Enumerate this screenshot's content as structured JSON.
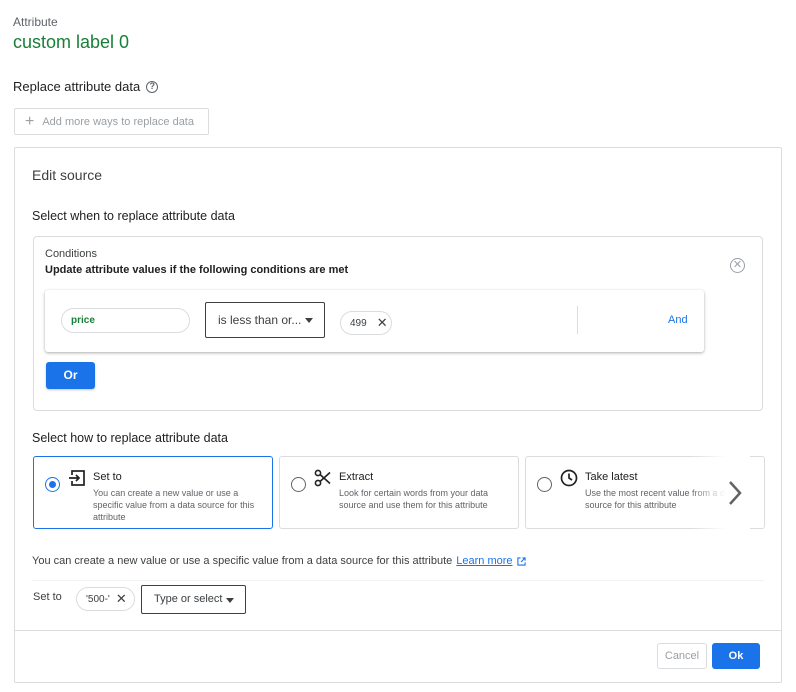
{
  "attribute": {
    "caption": "Attribute",
    "value": "custom label 0"
  },
  "replace_section": {
    "title": "Replace attribute data",
    "help_icon": "help-circle-icon",
    "add_more_label": "Add more ways to replace data"
  },
  "edit_source": {
    "title": "Edit source",
    "select_when_title": "Select when to replace attribute data",
    "conditions": {
      "title": "Conditions",
      "subtitle": "Update attribute values if the following conditions are met",
      "rule": {
        "attribute": "price",
        "operator": "is less than or...",
        "value": "499",
        "and_label": "And"
      },
      "or_label": "Or"
    },
    "select_how_title": "Select how to replace attribute data",
    "options": [
      {
        "icon": "input-arrow-icon",
        "title": "Set to",
        "description": "You can create a new value or use a specific value from a data source for this attribute",
        "selected": true
      },
      {
        "icon": "scissors-icon",
        "title": "Extract",
        "description": "Look for certain words from your data source and use them for this attribute",
        "selected": false
      },
      {
        "icon": "clock-icon",
        "title": "Take latest",
        "description": "Use the most recent value from a data source for this attribute",
        "selected": false
      }
    ],
    "info_text": "You can create a new value or use a specific value from a data source for this attribute",
    "learn_more": "Learn more",
    "set_to": {
      "label": "Set to",
      "chip_value": "'500-'",
      "type_select_label": "Type or select"
    }
  },
  "footer": {
    "cancel_label": "Cancel",
    "ok_label": "Ok"
  },
  "colors": {
    "accent": "#1a73e8",
    "green": "#188038",
    "border": "#dadce0"
  }
}
